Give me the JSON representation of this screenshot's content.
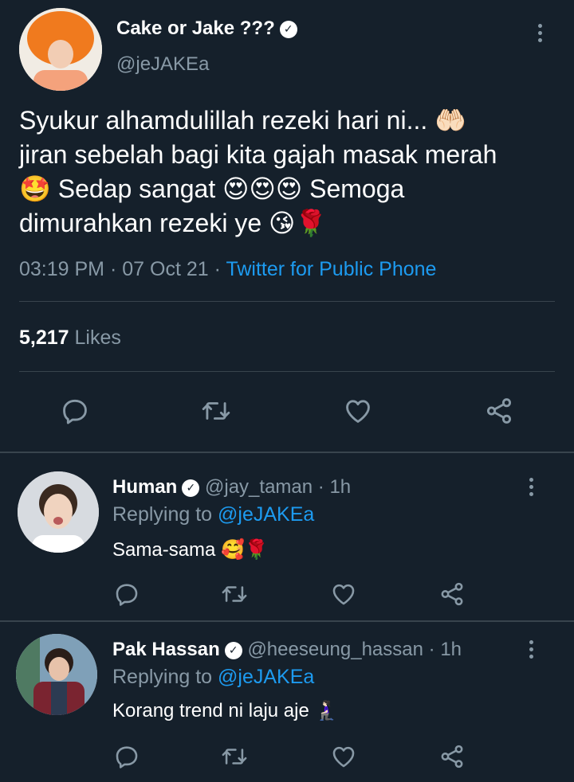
{
  "tweet": {
    "author_name": "Cake or Jake ???",
    "author_handle": "@jeJAKEa",
    "text": "Syukur alhamdulillah rezeki hari ni... 🤲🏻\njiran sebelah bagi kita gajah masak merah\n🤩 Sedap sangat 😍😍😍 Semoga\ndimurahkan rezeki ye 😘🌹",
    "time": "03:19 PM",
    "date": "07 Oct 21",
    "separator": "·",
    "source": "Twitter for Public Phone",
    "likes_count": "5,217",
    "likes_label": "Likes"
  },
  "replies": [
    {
      "name": "Human",
      "handle": "@jay_taman",
      "time": "· 1h",
      "replying_label": "Replying to",
      "replying_to": "@jeJAKEa",
      "text": "Sama-sama 🥰🌹"
    },
    {
      "name": "Pak Hassan",
      "handle": "@heeseung_hassan",
      "time": "· 1h",
      "replying_label": "Replying to",
      "replying_to": "@jeJAKEa",
      "text": "Korang trend ni laju aje 🧎🏻‍♀️"
    }
  ],
  "icons": {
    "reply": "reply-icon",
    "retweet": "retweet-icon",
    "like": "heart-icon",
    "share": "share-icon",
    "more": "more-vertical-icon",
    "verified": "verified-badge-icon"
  },
  "colors": {
    "background": "#15202b",
    "muted": "#8899a6",
    "link": "#1d9bf0",
    "divider": "#38444d"
  }
}
